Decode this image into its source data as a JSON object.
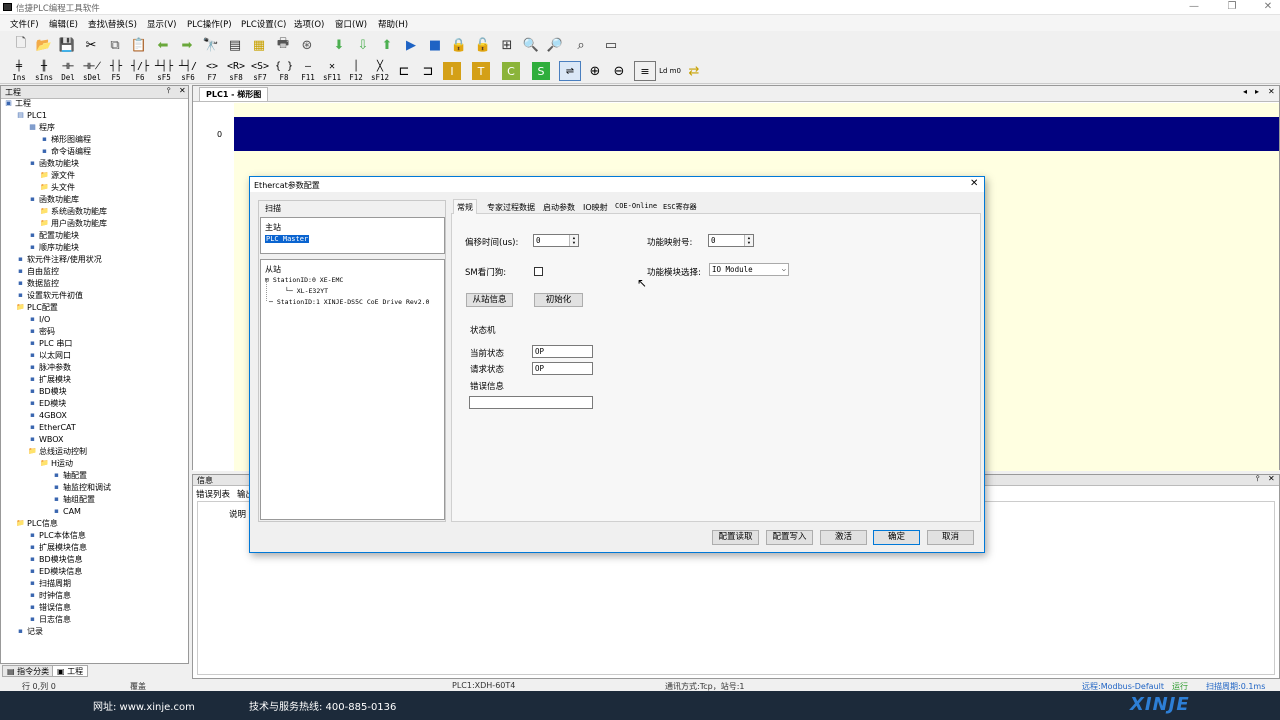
{
  "app": {
    "title": "信捷PLC编程工具软件",
    "window_controls": [
      "—",
      "❐",
      "✕"
    ]
  },
  "menu": [
    "文件(F)",
    "编辑(E)",
    "查找\\替换(S)",
    "显示(V)",
    "PLC操作(P)",
    "PLC设置(C)",
    "选项(O)",
    "窗口(W)",
    "帮助(H)"
  ],
  "ladder_toolbar": [
    "Ins",
    "sIns",
    "Del",
    "sDel",
    "F5",
    "F6",
    "sF5",
    "sF6",
    "F7",
    "sF8",
    "sF7",
    "F8",
    "F11",
    "sF11",
    "F12",
    "sF12"
  ],
  "project_panel": {
    "header": "工程",
    "items": [
      {
        "label": "工程",
        "icon": "project-icon",
        "level": 0
      },
      {
        "label": "PLC1",
        "icon": "plc-icon",
        "level": 1
      },
      {
        "label": "程序",
        "icon": "program-icon",
        "level": 2
      },
      {
        "label": "梯形图编程",
        "icon": "ladder-icon",
        "level": 3
      },
      {
        "label": "命令语编程",
        "icon": "instruction-icon",
        "level": 3
      },
      {
        "label": "函数功能块",
        "icon": "function-block-icon",
        "level": 2
      },
      {
        "label": "源文件",
        "icon": "folder-icon",
        "level": 3
      },
      {
        "label": "头文件",
        "icon": "folder-icon",
        "level": 3
      },
      {
        "label": "函数功能库",
        "icon": "function-lib-icon",
        "level": 2
      },
      {
        "label": "系统函数功能库",
        "icon": "folder-icon",
        "level": 3
      },
      {
        "label": "用户函数功能库",
        "icon": "folder-icon",
        "level": 3
      },
      {
        "label": "配置功能块",
        "icon": "config-block-icon",
        "level": 2
      },
      {
        "label": "顺序功能块",
        "icon": "sequence-block-icon",
        "level": 2
      },
      {
        "label": "软元件注释/使用状况",
        "icon": "comment-icon",
        "level": 1
      },
      {
        "label": "自由监控",
        "icon": "monitor-icon",
        "level": 1
      },
      {
        "label": "数据监控",
        "icon": "data-monitor-icon",
        "level": 1
      },
      {
        "label": "设置软元件初值",
        "icon": "init-value-icon",
        "level": 1
      },
      {
        "label": "PLC配置",
        "icon": "folder-icon",
        "level": 1
      },
      {
        "label": "I/O",
        "icon": "io-icon",
        "level": 2
      },
      {
        "label": "密码",
        "icon": "password-icon",
        "level": 2
      },
      {
        "label": "PLC 串口",
        "icon": "serial-icon",
        "level": 2
      },
      {
        "label": "以太网口",
        "icon": "ethernet-icon",
        "level": 2
      },
      {
        "label": "脉冲参数",
        "icon": "pulse-icon",
        "level": 2
      },
      {
        "label": "扩展模块",
        "icon": "expansion-icon",
        "level": 2
      },
      {
        "label": "BD模块",
        "icon": "bd-icon",
        "level": 2
      },
      {
        "label": "ED模块",
        "icon": "ed-icon",
        "level": 2
      },
      {
        "label": "4GBOX",
        "icon": "4gbox-icon",
        "level": 2
      },
      {
        "label": "EtherCAT",
        "icon": "ethercat-icon",
        "level": 2
      },
      {
        "label": "WBOX",
        "icon": "wbox-icon",
        "level": 2
      },
      {
        "label": "总线运动控制",
        "icon": "folder-icon",
        "level": 2
      },
      {
        "label": "H运动",
        "icon": "folder-icon",
        "level": 3
      },
      {
        "label": "轴配置",
        "icon": "axis-icon",
        "level": 4
      },
      {
        "label": "轴监控和调试",
        "icon": "axis-monitor-icon",
        "level": 4
      },
      {
        "label": "轴组配置",
        "icon": "axis-group-icon",
        "level": 4
      },
      {
        "label": "CAM",
        "icon": "cam-icon",
        "level": 4
      },
      {
        "label": "PLC信息",
        "icon": "folder-icon",
        "level": 1
      },
      {
        "label": "PLC本体信息",
        "icon": "plc-info-icon",
        "level": 2
      },
      {
        "label": "扩展模块信息",
        "icon": "expansion-info-icon",
        "level": 2
      },
      {
        "label": "BD模块信息",
        "icon": "bd-info-icon",
        "level": 2
      },
      {
        "label": "ED模块信息",
        "icon": "ed-info-icon",
        "level": 2
      },
      {
        "label": "扫描周期",
        "icon": "scan-icon",
        "level": 2
      },
      {
        "label": "时钟信息",
        "icon": "clock-icon",
        "level": 2
      },
      {
        "label": "错误信息",
        "icon": "error-icon",
        "level": 2
      },
      {
        "label": "日志信息",
        "icon": "log-icon",
        "level": 2
      },
      {
        "label": "记录",
        "icon": "record-icon",
        "level": 1
      }
    ],
    "bottom_tabs": [
      "指令分类",
      "工程"
    ]
  },
  "editor": {
    "tab": "PLC1 - 梯形图",
    "rung_number": "0"
  },
  "info_panel": {
    "header": "信息",
    "tabs": [
      "错误列表",
      "输出"
    ],
    "column": "说明"
  },
  "dialog": {
    "title": "Ethercat参数配置",
    "scan_group": "扫描",
    "master_label": "主站",
    "master_item": "PLC Master",
    "slave_label": "从站",
    "slaves": [
      "StationID:0 XE-EMC",
      "XL-E32YT",
      "StationID:1 XINJE-DS5C CoE Drive Rev2.0"
    ],
    "tabs": [
      "常规",
      "专家过程数据",
      "启动参数",
      "IO映射",
      "COE-Online",
      "ESC寄存器"
    ],
    "offset_time_label": "偏移时间(us):",
    "offset_time_value": "0",
    "func_map_label": "功能映射号:",
    "func_map_value": "0",
    "watchdog_label": "SM看门狗:",
    "func_module_label": "功能模块选择:",
    "func_module_value": "IO Module",
    "slave_info_button": "从站信息",
    "init_button": "初始化",
    "state_machine_label": "状态机",
    "current_state_label": "当前状态",
    "current_state_value": "OP",
    "request_state_label": "请求状态",
    "request_state_value": "OP",
    "error_info_label": "错误信息",
    "buttons": [
      "配置读取",
      "配置写入",
      "激活",
      "确定",
      "取消"
    ]
  },
  "status_bar": {
    "position": "行 0,列 0",
    "mode": "覆盖",
    "plc": "PLC1:XDH-60T4",
    "comm": "通讯方式:Tcp，站号:1",
    "protocol": "远程:Modbus-Default",
    "run": "运行",
    "scan": "扫描周期:0.1ms"
  },
  "footer": {
    "website": "网址:  www.xinje.com",
    "hotline": "技术与服务热线: 400-885-0136",
    "brand": "XINJE"
  },
  "colors": {
    "rung": "#000080",
    "ladder_bg": "#ffffe1",
    "footer_bg": "#1c2a3a",
    "dialog_border": "#0078d7",
    "brand": "#2d7fd6",
    "selection": "#0a64d0"
  }
}
